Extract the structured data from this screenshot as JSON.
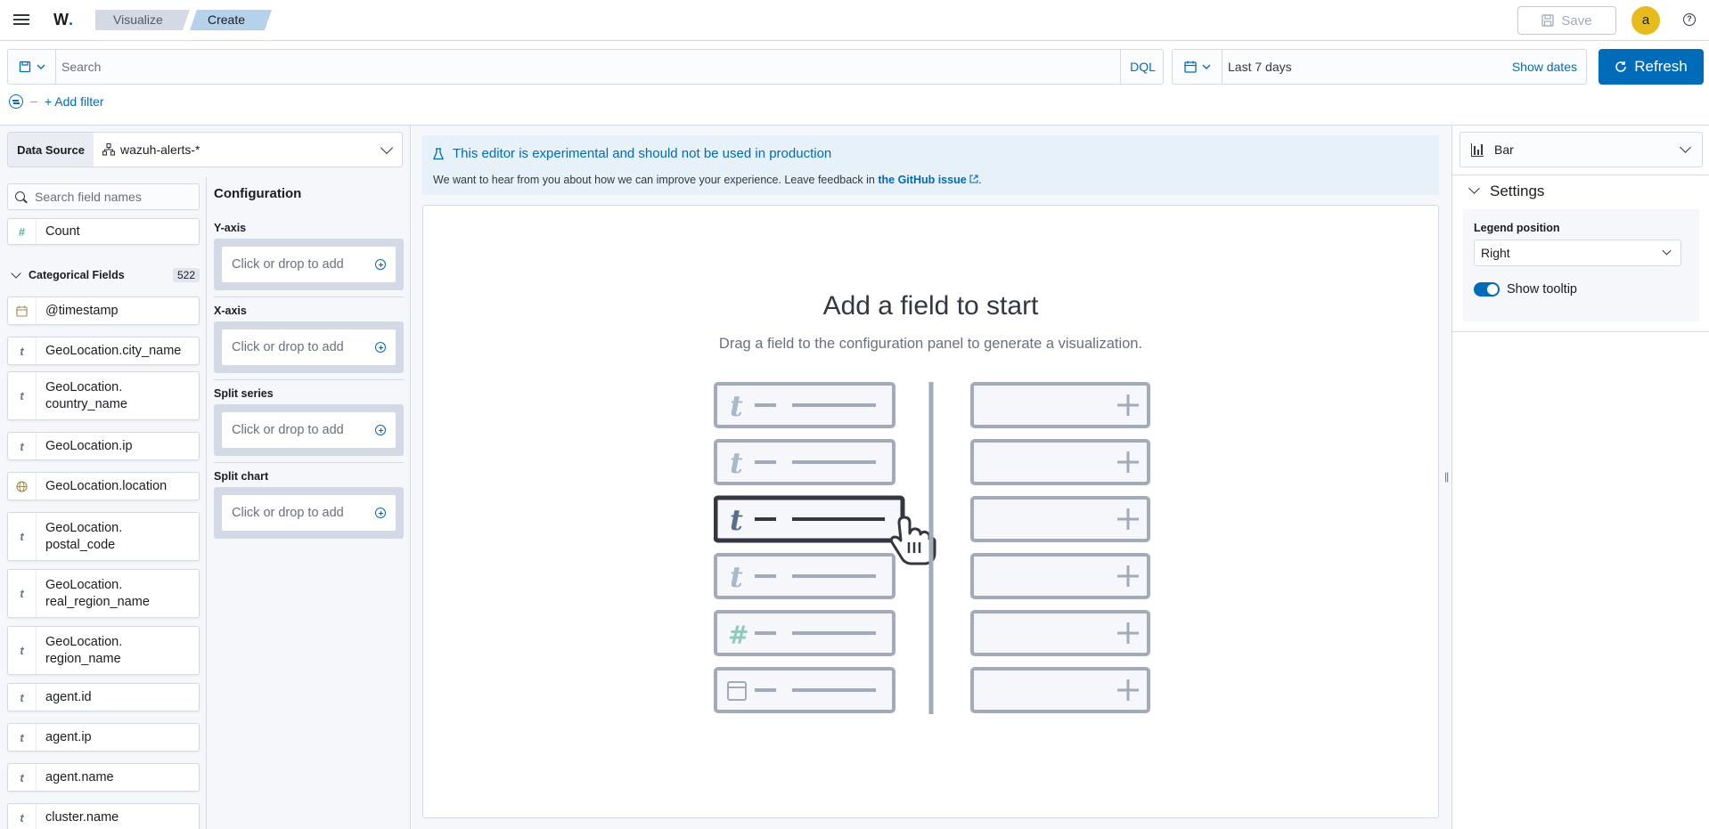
{
  "header": {
    "logo": "W",
    "breadcrumbs": [
      "Visualize",
      "Create"
    ],
    "save_label": "Save",
    "avatar_initial": "a"
  },
  "query": {
    "search_placeholder": "Search",
    "language": "DQL",
    "date_range": "Last 7 days",
    "show_dates": "Show dates",
    "refresh_label": "Refresh",
    "add_filter": "+ Add filter"
  },
  "data_source": {
    "label": "Data Source",
    "value": "wazuh-alerts-*"
  },
  "fields_panel": {
    "search_placeholder": "Search field names",
    "count_field": {
      "type": "number",
      "name": "Count"
    },
    "categorical_label": "Categorical Fields",
    "categorical_count": "522",
    "fields": [
      {
        "type": "date",
        "name": "@timestamp"
      },
      {
        "type": "string",
        "name": "GeoLocation.city_name"
      },
      {
        "type": "string",
        "name": "GeoLocation.\ncountry_name"
      },
      {
        "type": "string",
        "name": "GeoLocation.ip"
      },
      {
        "type": "geo",
        "name": "GeoLocation.location"
      },
      {
        "type": "string",
        "name": "GeoLocation.\npostal_code"
      },
      {
        "type": "string",
        "name": "GeoLocation.\nreal_region_name"
      },
      {
        "type": "string",
        "name": "GeoLocation.\nregion_name"
      },
      {
        "type": "string",
        "name": "agent.id"
      },
      {
        "type": "string",
        "name": "agent.ip"
      },
      {
        "type": "string",
        "name": "agent.name"
      },
      {
        "type": "string",
        "name": "cluster.name"
      }
    ]
  },
  "configuration": {
    "title": "Configuration",
    "sections": [
      {
        "label": "Y-axis",
        "placeholder": "Click or drop to add"
      },
      {
        "label": "X-axis",
        "placeholder": "Click or drop to add"
      },
      {
        "label": "Split series",
        "placeholder": "Click or drop to add"
      },
      {
        "label": "Split chart",
        "placeholder": "Click or drop to add"
      }
    ]
  },
  "callout": {
    "title": "This editor is experimental and should not be used in production",
    "text": "We want to hear from you about how we can improve your experience. Leave feedback in ",
    "link": "the GitHub issue",
    "after": "."
  },
  "empty_state": {
    "title": "Add a field to start",
    "text": "Drag a field to the configuration panel to generate a visualization."
  },
  "right_panel": {
    "chart_type": "Bar",
    "settings_title": "Settings",
    "legend_position_label": "Legend position",
    "legend_position_value": "Right",
    "show_tooltip_label": "Show tooltip",
    "show_tooltip_on": true
  },
  "colors": {
    "primary": "#006bb8",
    "crumb_inactive": "#d3dae6",
    "crumb_active": "#b6d1ea",
    "avatar": "#e7bb1d",
    "callout_bg": "#e6f1fa"
  }
}
